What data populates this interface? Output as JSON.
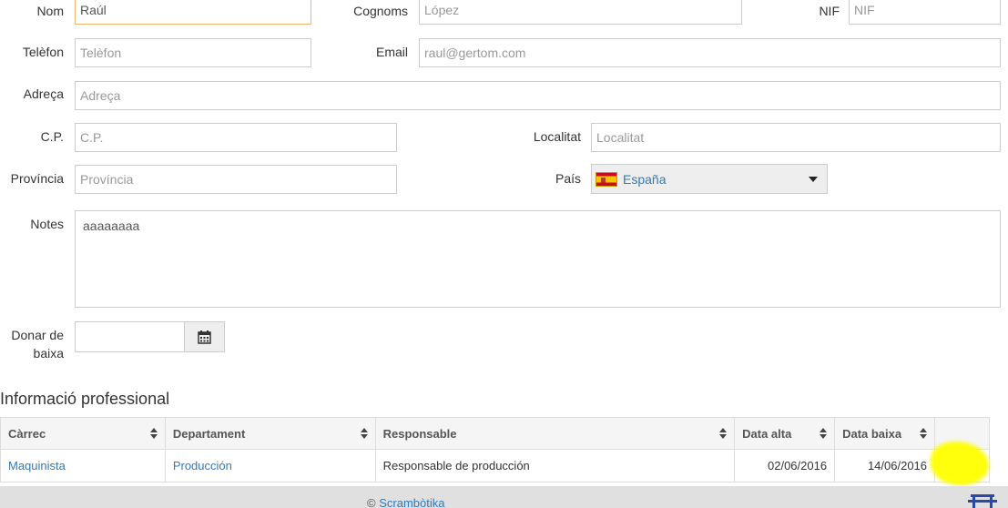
{
  "form": {
    "nom": {
      "label": "Nom",
      "value": "Raúl"
    },
    "cognoms": {
      "label": "Cognoms",
      "value": "López"
    },
    "nif": {
      "label": "NIF",
      "placeholder": "NIF"
    },
    "telefon": {
      "label": "Telèfon",
      "placeholder": "Telèfon"
    },
    "email": {
      "label": "Email",
      "placeholder": "raul@gertom.com"
    },
    "adreca": {
      "label": "Adreça",
      "placeholder": "Adreça"
    },
    "cp": {
      "label": "C.P.",
      "placeholder": "C.P."
    },
    "localitat": {
      "label": "Localitat",
      "placeholder": "Localitat"
    },
    "provincia": {
      "label": "Província",
      "placeholder": "Província"
    },
    "pais": {
      "label": "País",
      "value": "España",
      "flag": "spain-flag-icon"
    },
    "notes": {
      "label": "Notes",
      "value": "aaaaaaaa"
    },
    "donar_baixa": {
      "label_line1": "Donar de",
      "label_line2": "baixa",
      "value": "",
      "icon": "calendar-icon"
    }
  },
  "professional": {
    "title": "Informació professional",
    "columns": [
      "Càrrec",
      "Departament",
      "Responsable",
      "Data alta",
      "Data baixa",
      ""
    ],
    "rows": [
      {
        "carrec": "Maquinista",
        "departament": "Producción",
        "responsable": "Responsable de producción",
        "data_alta": "02/06/2016",
        "data_baixa": "14/06/2016"
      }
    ]
  },
  "footer": {
    "copyright": "©",
    "brand": "Scrambòtika"
  },
  "colors": {
    "link": "#337ab7",
    "highlight": "#ffff00",
    "focus_border": "#e8b76a"
  }
}
